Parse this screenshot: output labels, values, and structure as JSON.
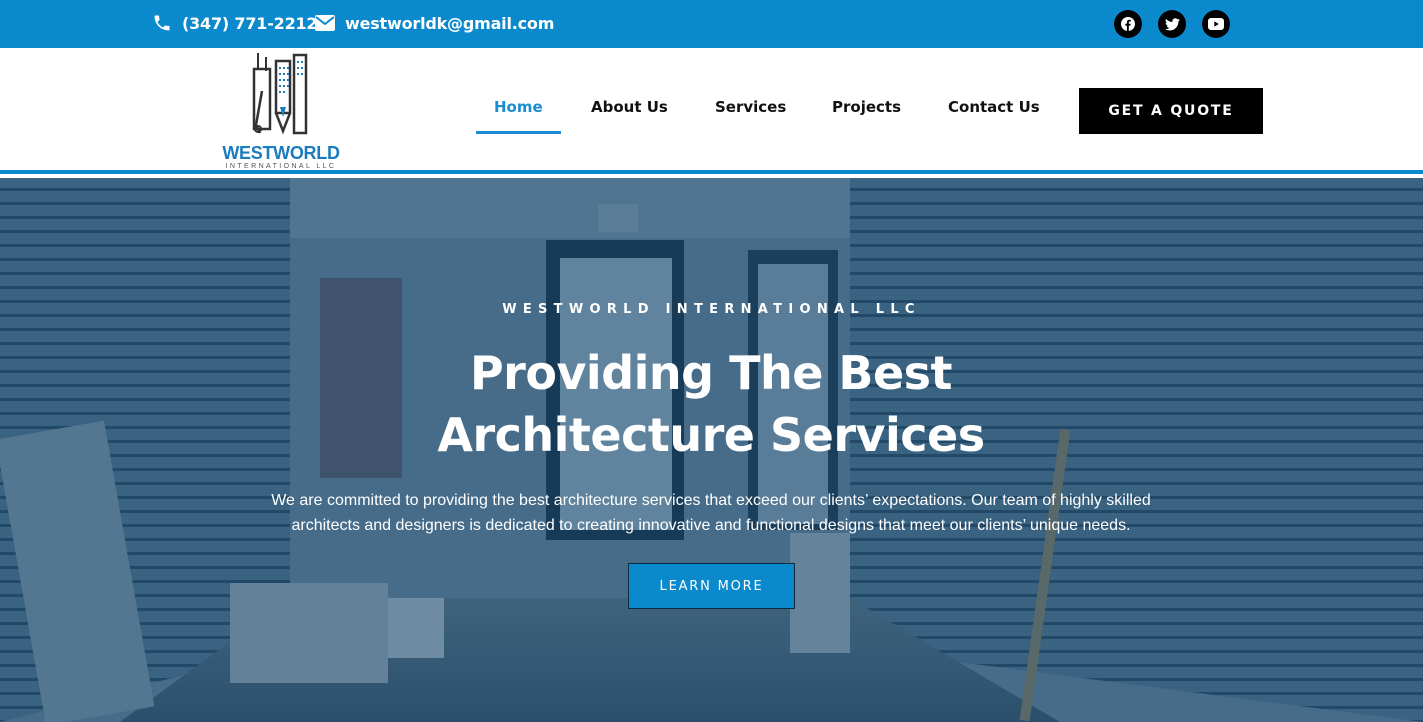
{
  "topbar": {
    "phone": "(347) 771-2212",
    "phone_icon": "phone-icon",
    "email": "westworldk@gmail.com",
    "email_icon": "envelope-icon",
    "social": [
      "facebook-icon",
      "twitter-icon",
      "youtube-icon"
    ],
    "bg_color": "#0a8acd"
  },
  "logo": {
    "name": "WESTWORLD",
    "subtitle": "INTERNATIONAL LLC"
  },
  "nav": {
    "items": [
      {
        "label": "Home",
        "active": true
      },
      {
        "label": "About Us",
        "active": false
      },
      {
        "label": "Services",
        "active": false
      },
      {
        "label": "Projects",
        "active": false
      },
      {
        "label": "Contact Us",
        "active": false
      }
    ],
    "cta": "GET A QUOTE",
    "accent_color": "#1b8cd0"
  },
  "hero": {
    "eyebrow": "WESTWORLD INTERNATIONAL LLC",
    "title_line1": "Providing The Best",
    "title_line2": "Architecture Services",
    "body_line1": "We are committed to providing the best architecture services that exceed our clients’ expectations. Our team of highly skilled",
    "body_line2": "architects and designers is dedicated to creating innovative and functional designs that meet our clients’ unique needs.",
    "button": "LEARN MORE",
    "background": "photo of an empty commercial interior corridor with slatwall panels, an exit sign and an open door"
  }
}
